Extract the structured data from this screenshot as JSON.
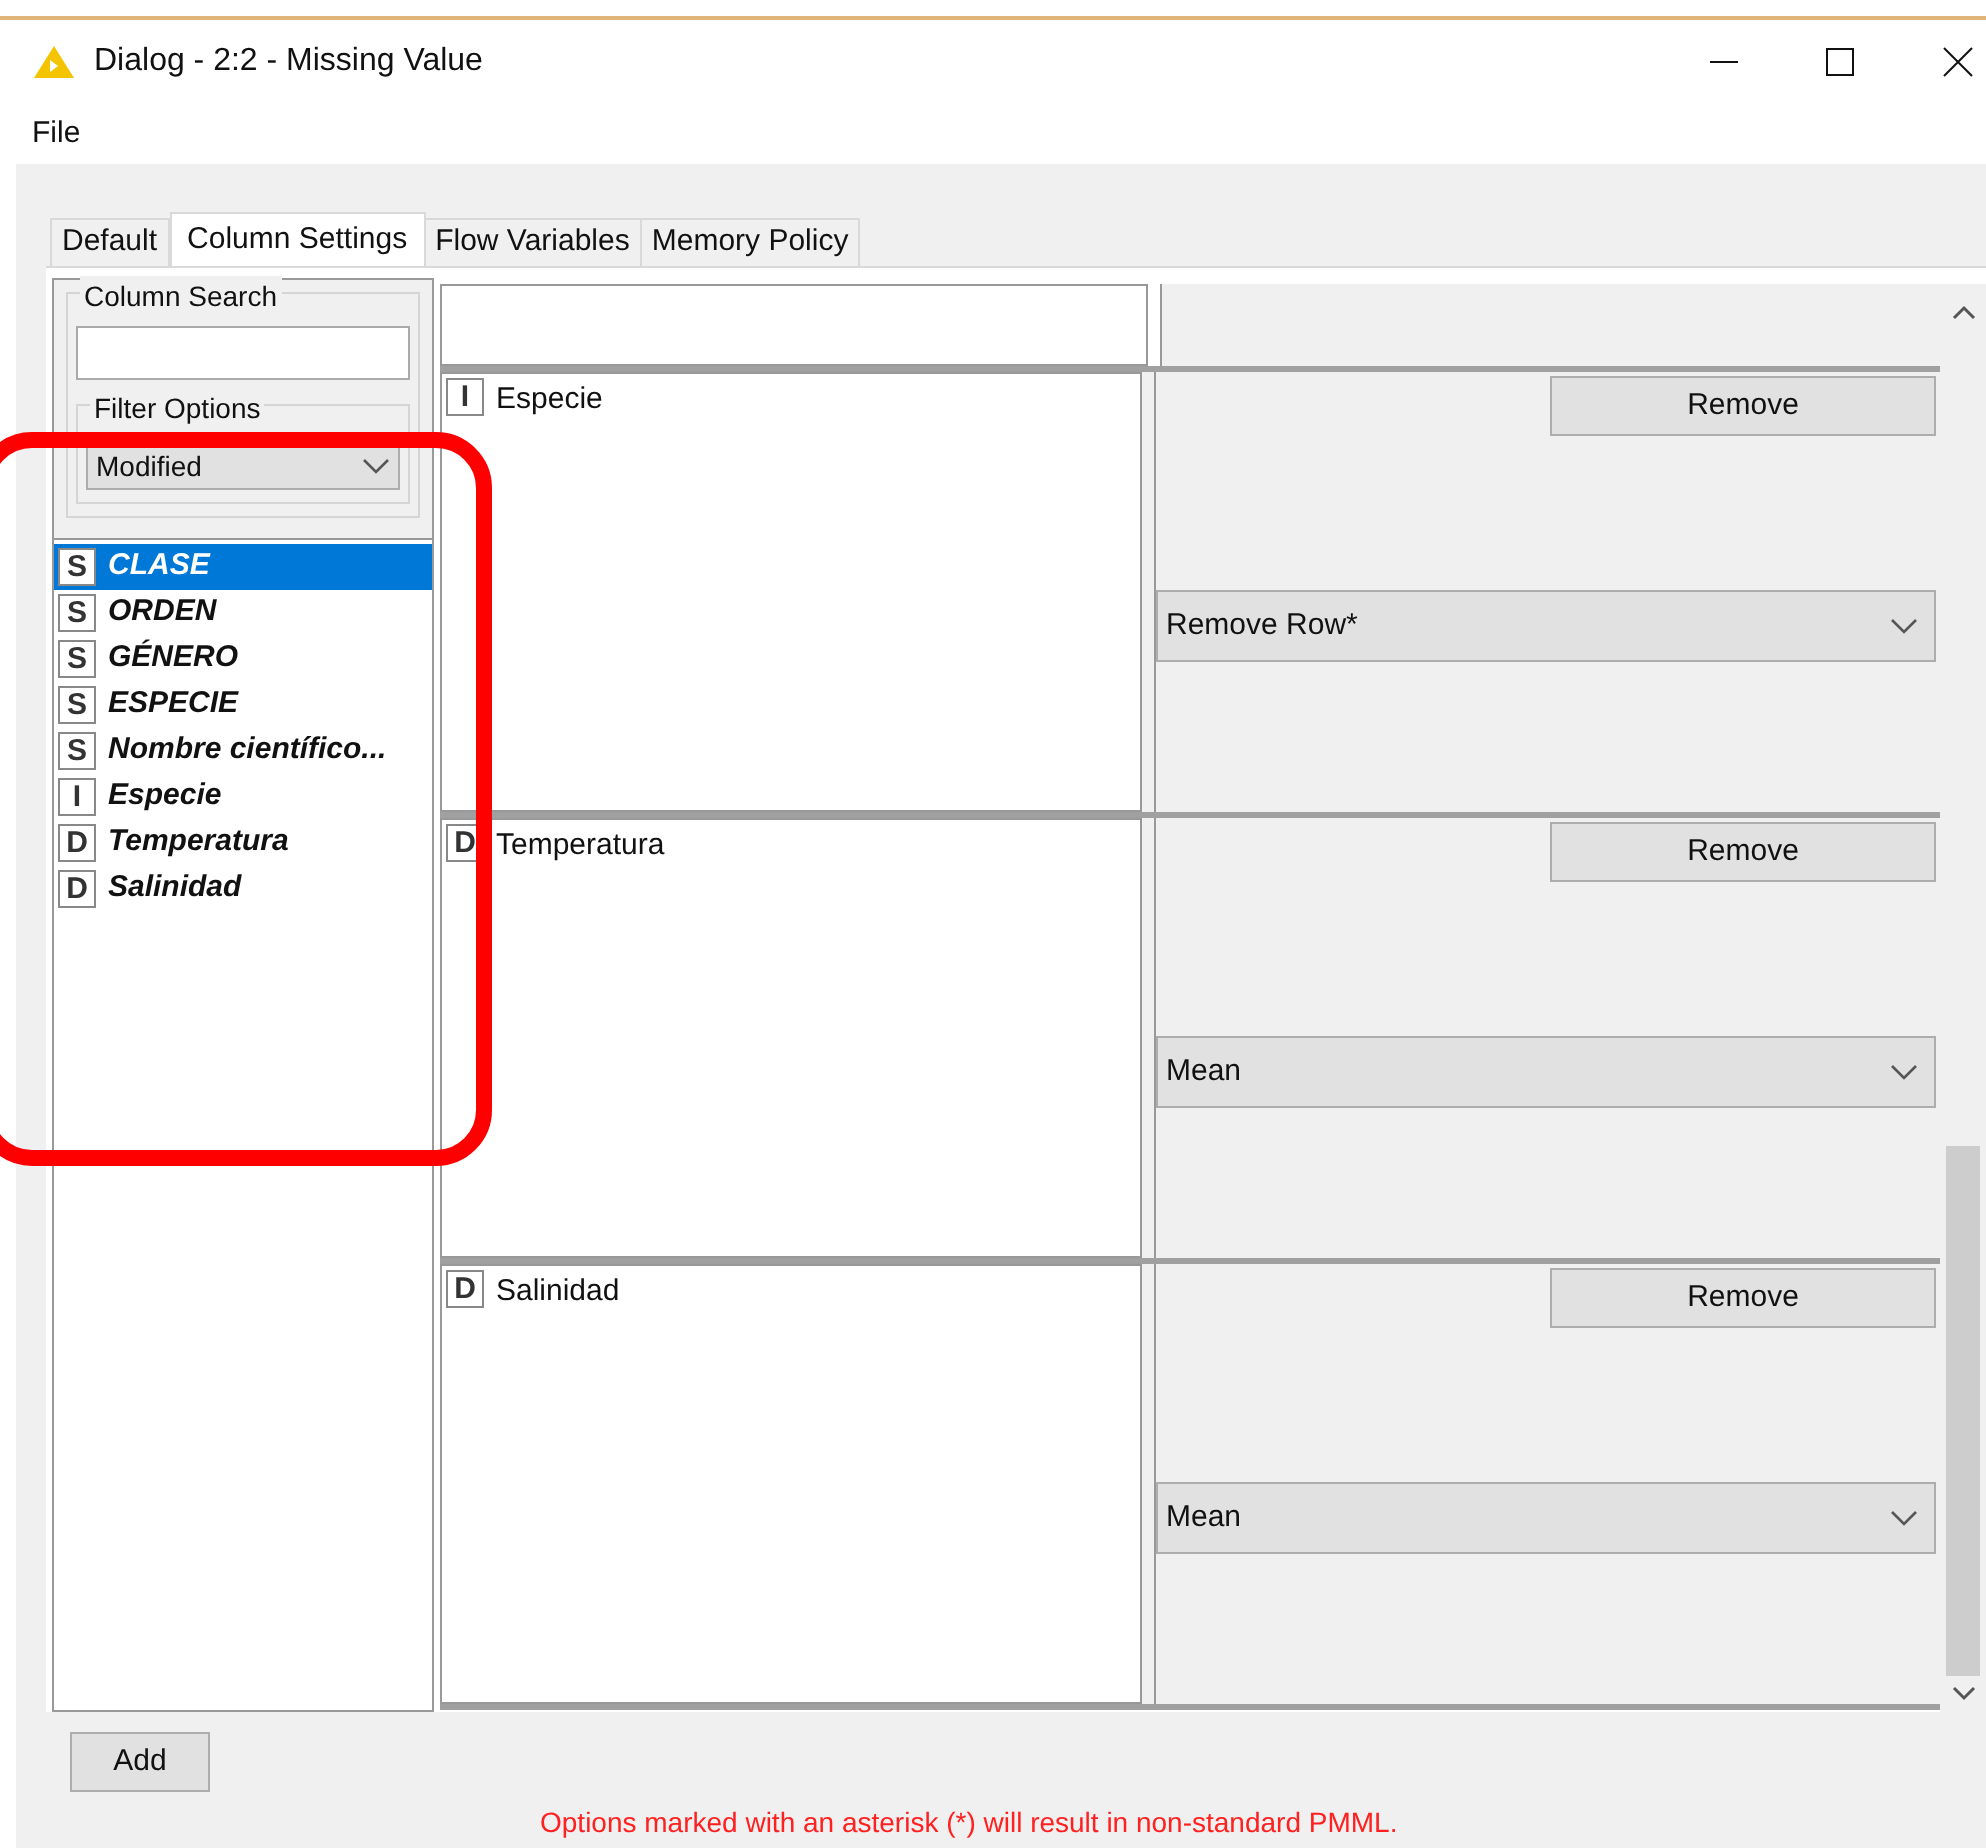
{
  "window": {
    "title": "Dialog - 2:2 - Missing Value"
  },
  "menu": [
    "File"
  ],
  "tabs": [
    {
      "label": "Default",
      "selected": false
    },
    {
      "label": "Column Settings",
      "selected": true
    },
    {
      "label": "Flow Variables",
      "selected": false
    },
    {
      "label": "Memory Policy",
      "selected": false
    }
  ],
  "column_search": {
    "label": "Column Search"
  },
  "filter_options": {
    "label": "Filter Options",
    "value": "Modified"
  },
  "columns": [
    {
      "type": "S",
      "name": "CLASE",
      "selected": true
    },
    {
      "type": "S",
      "name": "ORDEN",
      "selected": false
    },
    {
      "type": "S",
      "name": "GÉNERO",
      "selected": false
    },
    {
      "type": "S",
      "name": "ESPECIE",
      "selected": false
    },
    {
      "type": "S",
      "name": "Nombre científico...",
      "selected": false
    },
    {
      "type": "I",
      "name": "Especie",
      "selected": false
    },
    {
      "type": "D",
      "name": "Temperatura",
      "selected": false
    },
    {
      "type": "D",
      "name": "Salinidad",
      "selected": false
    }
  ],
  "settings": [
    {
      "type": "I",
      "name": "Especie",
      "remove": "Remove",
      "method": "Remove Row*"
    },
    {
      "type": "D",
      "name": "Temperatura",
      "remove": "Remove",
      "method": "Mean"
    },
    {
      "type": "D",
      "name": "Salinidad",
      "remove": "Remove",
      "method": "Mean"
    }
  ],
  "add_button": "Add",
  "note": "Options marked with an asterisk (*) will result in non-standard PMML."
}
